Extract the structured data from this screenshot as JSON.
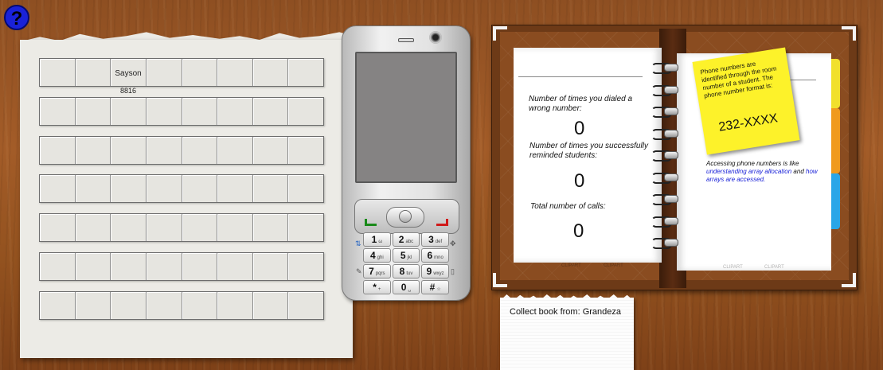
{
  "help": {
    "label": "?"
  },
  "schedule": {
    "rows": [
      [
        "",
        "",
        "Sayson",
        "",
        "",
        "",
        "",
        ""
      ],
      [
        "",
        "",
        "",
        "",
        "",
        "",
        "",
        ""
      ],
      [
        "",
        "",
        "",
        "",
        "",
        "",
        "",
        ""
      ],
      [
        "",
        "",
        "",
        "",
        "",
        "",
        "",
        ""
      ],
      [
        "",
        "",
        "",
        "",
        "",
        "",
        "",
        ""
      ],
      [
        "",
        "",
        "",
        "",
        "",
        "",
        "",
        ""
      ],
      [
        "",
        "",
        "",
        "",
        "",
        "",
        "",
        ""
      ]
    ],
    "extension": "8816"
  },
  "phone": {
    "keys": [
      {
        "main": "1",
        "sub": "ω"
      },
      {
        "main": "2",
        "sub": "abc"
      },
      {
        "main": "3",
        "sub": "def"
      },
      {
        "main": "4",
        "sub": "ghi"
      },
      {
        "main": "5",
        "sub": "jkl"
      },
      {
        "main": "6",
        "sub": "mno"
      },
      {
        "main": "7",
        "sub": "pqrs"
      },
      {
        "main": "8",
        "sub": "tuv"
      },
      {
        "main": "9",
        "sub": "wxyz"
      },
      {
        "main": "*",
        "sub": "+"
      },
      {
        "main": "0",
        "sub": "␣"
      },
      {
        "main": "#",
        "sub": "☆"
      }
    ]
  },
  "notebook": {
    "wrong_label": "Number of times you dialed a wrong number:",
    "wrong_count": "0",
    "success_label": "Number of times you successfully reminded students:",
    "success_count": "0",
    "total_label": "Total number of calls:",
    "total_count": "0",
    "sticky_text": "Phone numbers are identified through the room number of a student. The phone number format is:",
    "sticky_format": "232-XXXX",
    "access_text": "Accessing phone numbers is like",
    "access_link": "understanding array allocation",
    "access_and": "and",
    "access_link2": "how arrays are accessed.",
    "watermark": "CLIPART"
  },
  "collect_note": {
    "text": "Collect book from: Grandeza"
  },
  "colors": {
    "help": "#1a22d8",
    "sticky": "#fdf22a",
    "tab_yellow": "#f1e02c",
    "tab_orange": "#f09a1d",
    "tab_blue": "#2aa6e8"
  }
}
